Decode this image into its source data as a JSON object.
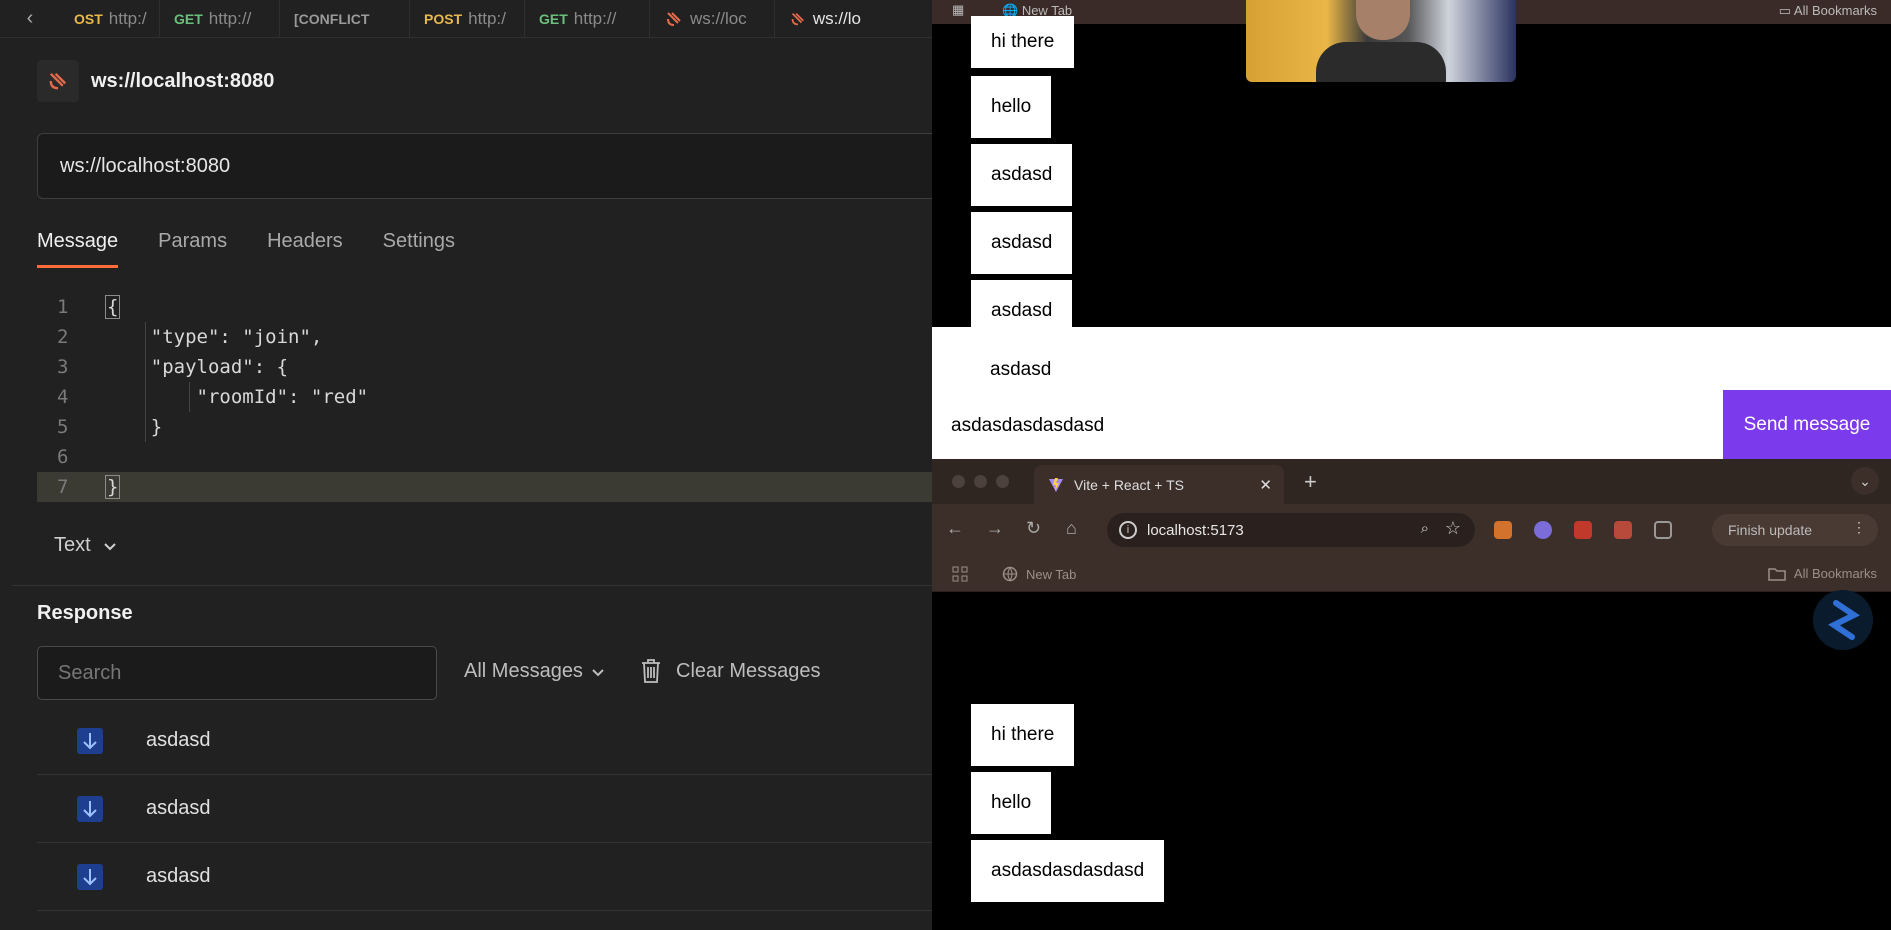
{
  "left": {
    "tabs": [
      {
        "method": "OST",
        "url": "http:/"
      },
      {
        "method": "GET",
        "url": "http://"
      },
      {
        "method": "[CONFLICT",
        "url": ""
      },
      {
        "method": "POST",
        "url": "http:/"
      },
      {
        "method": "GET",
        "url": "http://"
      },
      {
        "method": "",
        "url": "ws://loc"
      },
      {
        "method": "",
        "url": "ws://lo"
      }
    ],
    "request_title": "ws://localhost:8080",
    "url_value": "ws://localhost:8080",
    "subtabs": [
      "Message",
      "Params",
      "Headers",
      "Settings"
    ],
    "editor": {
      "line_numbers": [
        "1",
        "2",
        "3",
        "4",
        "5",
        "6",
        "7"
      ],
      "lines": [
        "{",
        "    \"type\": \"join\",",
        "    \"payload\": {",
        "        \"roomId\": \"red\"",
        "    }",
        "",
        "}"
      ]
    },
    "body_format": "Text",
    "response": {
      "title": "Response",
      "search_placeholder": "Search",
      "filter_label": "All Messages",
      "clear_label": "Clear Messages",
      "messages": [
        "asdasd",
        "asdasd",
        "asdasd"
      ]
    }
  },
  "right": {
    "top_bookmarks": {
      "new_tab": "New Tab",
      "all": "All Bookmarks"
    },
    "chat1_bubbles": [
      "hi there",
      "hello",
      "asdasd",
      "asdasd",
      "asdasd",
      "asdasd"
    ],
    "input_value": "asdasdasdasdasd",
    "send_label": "Send message",
    "browser2": {
      "tab_title": "Vite + React + TS",
      "address": "localhost:5173",
      "finish_update": "Finish update",
      "bookmarks": {
        "new_tab": "New Tab",
        "all": "All Bookmarks"
      }
    },
    "chat2_bubbles": [
      "hi there",
      "hello",
      "asdasdasdasdasd"
    ]
  },
  "colors": {
    "accent": "#ff6c37",
    "send": "#7c3aed",
    "arrow": "#1e3f8f"
  }
}
